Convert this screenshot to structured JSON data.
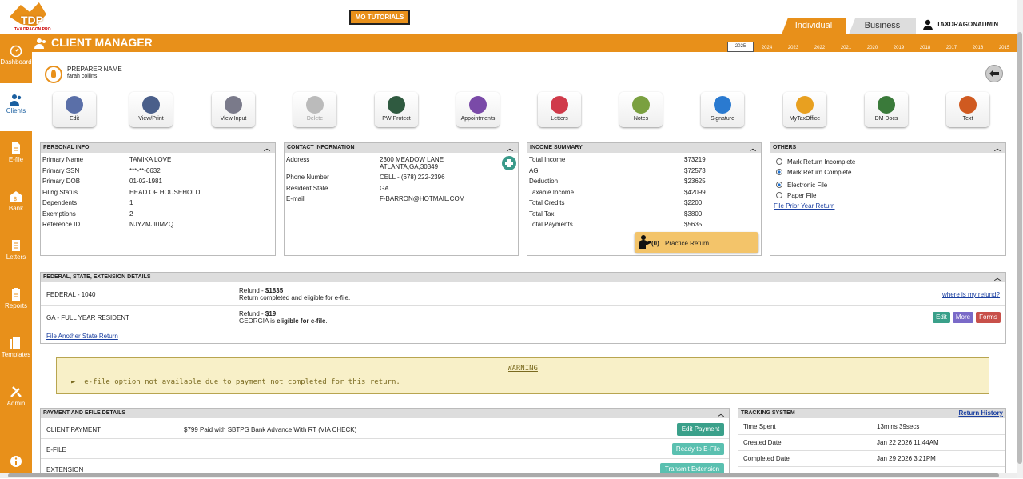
{
  "logo": {
    "text": "TDP",
    "sub": "TAX DRAGON PRO"
  },
  "top": {
    "tutorials": "MO TUTORIALS",
    "tab_individual": "Individual",
    "tab_business": "Business",
    "username": "TAXDRAGONADMIN"
  },
  "header": {
    "title": "CLIENT MANAGER"
  },
  "years": [
    "2025",
    "2024",
    "2023",
    "2022",
    "2021",
    "2020",
    "2019",
    "2018",
    "2017",
    "2016",
    "2015"
  ],
  "sidebar": [
    {
      "label": "Dashboard",
      "icon": "dashboard-icon"
    },
    {
      "label": "Clients",
      "icon": "clients-icon"
    },
    {
      "label": "E-file",
      "icon": "efile-icon"
    },
    {
      "label": "Bank",
      "icon": "bank-icon"
    },
    {
      "label": "Letters",
      "icon": "letters-icon"
    },
    {
      "label": "Reports",
      "icon": "reports-icon"
    },
    {
      "label": "Templates",
      "icon": "templates-icon"
    },
    {
      "label": "Admin",
      "icon": "admin-icon"
    }
  ],
  "preparer": {
    "label": "PREPARER NAME",
    "name": "farah collins"
  },
  "toolbar": [
    {
      "label": "Edit",
      "color": "#5a6fa8"
    },
    {
      "label": "View/Print",
      "color": "#4a5f8a"
    },
    {
      "label": "View Input",
      "color": "#7a7a8a"
    },
    {
      "label": "Delete",
      "color": "#bbbbbb"
    },
    {
      "label": "PW Protect",
      "color": "#2f5a40"
    },
    {
      "label": "Appointments",
      "color": "#7a4aa8"
    },
    {
      "label": "Letters",
      "color": "#d03a4a"
    },
    {
      "label": "Notes",
      "color": "#7aa040"
    },
    {
      "label": "Signature",
      "color": "#2a7ad0"
    },
    {
      "label": "MyTaxOffice",
      "color": "#e8a020"
    },
    {
      "label": "DM Docs",
      "color": "#3a7a3a"
    },
    {
      "label": "Text",
      "color": "#d05a20"
    }
  ],
  "personal": {
    "title": "PERSONAL INFO",
    "rows": [
      [
        "Primary Name",
        "TAMIKA LOVE"
      ],
      [
        "Primary SSN",
        "***-**-6632"
      ],
      [
        "Primary DOB",
        "01-02-1981"
      ],
      [
        "Filing Status",
        "HEAD OF HOUSEHOLD"
      ],
      [
        "Dependents",
        "1"
      ],
      [
        "Exemptions",
        "2"
      ],
      [
        "Reference ID",
        "NJYZMJI0MZQ"
      ]
    ]
  },
  "contact": {
    "title": "CONTACT INFORMATION",
    "address_label": "Address",
    "address_1": "2300 MEADOW LANE",
    "address_2": "ATLANTA,GA,30349",
    "phone_label": "Phone Number",
    "phone": "CELL - (678) 222-2396",
    "state_label": "Resident State",
    "state": "GA",
    "email_label": "E-mail",
    "email": "F-BARRON@HOTMAIL.COM"
  },
  "income": {
    "title": "INCOME SUMMARY",
    "rows": [
      [
        "Total Income",
        "$73219"
      ],
      [
        "AGI",
        "$72573"
      ],
      [
        "Deduction",
        "$23625"
      ],
      [
        "Taxable Income",
        "$42099"
      ],
      [
        "Total Credits",
        "$2200"
      ],
      [
        "Total Tax",
        "$3800"
      ],
      [
        "Total Payments",
        "$5635"
      ]
    ],
    "practice_count": "(0)",
    "practice_label": "Practice Return"
  },
  "others": {
    "title": "OTHERS",
    "mark_incomplete": "Mark Return Incomplete",
    "mark_complete": "Mark Return Complete",
    "electronic": "Electronic File",
    "paper": "Paper File",
    "prior_link": "File Prior Year Return"
  },
  "federal": {
    "title": "FEDERAL, STATE, EXTENSION DETAILS",
    "fed_label": "FEDERAL - 1040",
    "fed_refund_prefix": "Refund - ",
    "fed_refund": "$1835",
    "fed_status": "Return completed and eligible for e-file.",
    "where_link": "where is my refund?",
    "ga_label": "GA - FULL YEAR RESIDENT",
    "ga_refund_prefix": "Refund - ",
    "ga_refund": "$19",
    "ga_state": "GEORGIA",
    "ga_is": " is ",
    "ga_status": "eligible for e-file",
    "ga_period": ".",
    "btn_edit": "Edit",
    "btn_more": "More",
    "btn_forms": "Forms",
    "another_link": "File Another State Return"
  },
  "warning": {
    "title": "WARNING",
    "text": "e-file option not available due to payment not completed for this return."
  },
  "payment": {
    "title": "PAYMENT AND EFILE DETAILS",
    "client_payment_label": "CLIENT PAYMENT",
    "client_payment": "$799 Paid with SBTPG Bank Advance With RT (VIA CHECK)",
    "edit_payment": "Edit Payment",
    "efile_label": "E-FILE",
    "ready_btn": "Ready to E-File",
    "ext_label": "EXTENSION",
    "transmit_btn": "Transmit Extension"
  },
  "tracking": {
    "title": "TRACKING SYSTEM",
    "history_link": "Return History",
    "rows": [
      [
        "Time Spent",
        "13mins 39secs"
      ],
      [
        "Created Date",
        "Jan 22 2026 11:44AM"
      ],
      [
        "Completed Date",
        "Jan 29 2026 3:21PM"
      ]
    ]
  }
}
